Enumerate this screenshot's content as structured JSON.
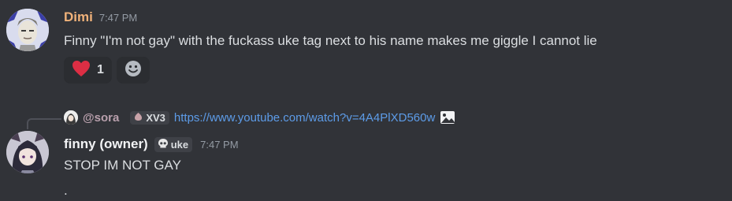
{
  "messages": [
    {
      "author": "Dimi",
      "author_color": "#f0b27a",
      "timestamp": "7:47 PM",
      "content": "Finny \"I'm not gay\" with the fuckass uke tag next to his name makes me giggle I cannot lie",
      "reactions": [
        {
          "emoji": "heart-icon",
          "count": "1"
        },
        {
          "emoji": "add-reaction-icon"
        }
      ]
    },
    {
      "reply": {
        "user": "@sora",
        "tag": "XV3",
        "link": "https://www.youtube.com/watch?v=4A4PlXD560w",
        "attachment_icon": "image-icon"
      },
      "author": "finny (owner)",
      "author_color": "#f2f3f5",
      "tag": "uke",
      "timestamp": "7:47 PM",
      "content_lines": [
        "STOP IM NOT GAY",
        "."
      ]
    }
  ]
}
